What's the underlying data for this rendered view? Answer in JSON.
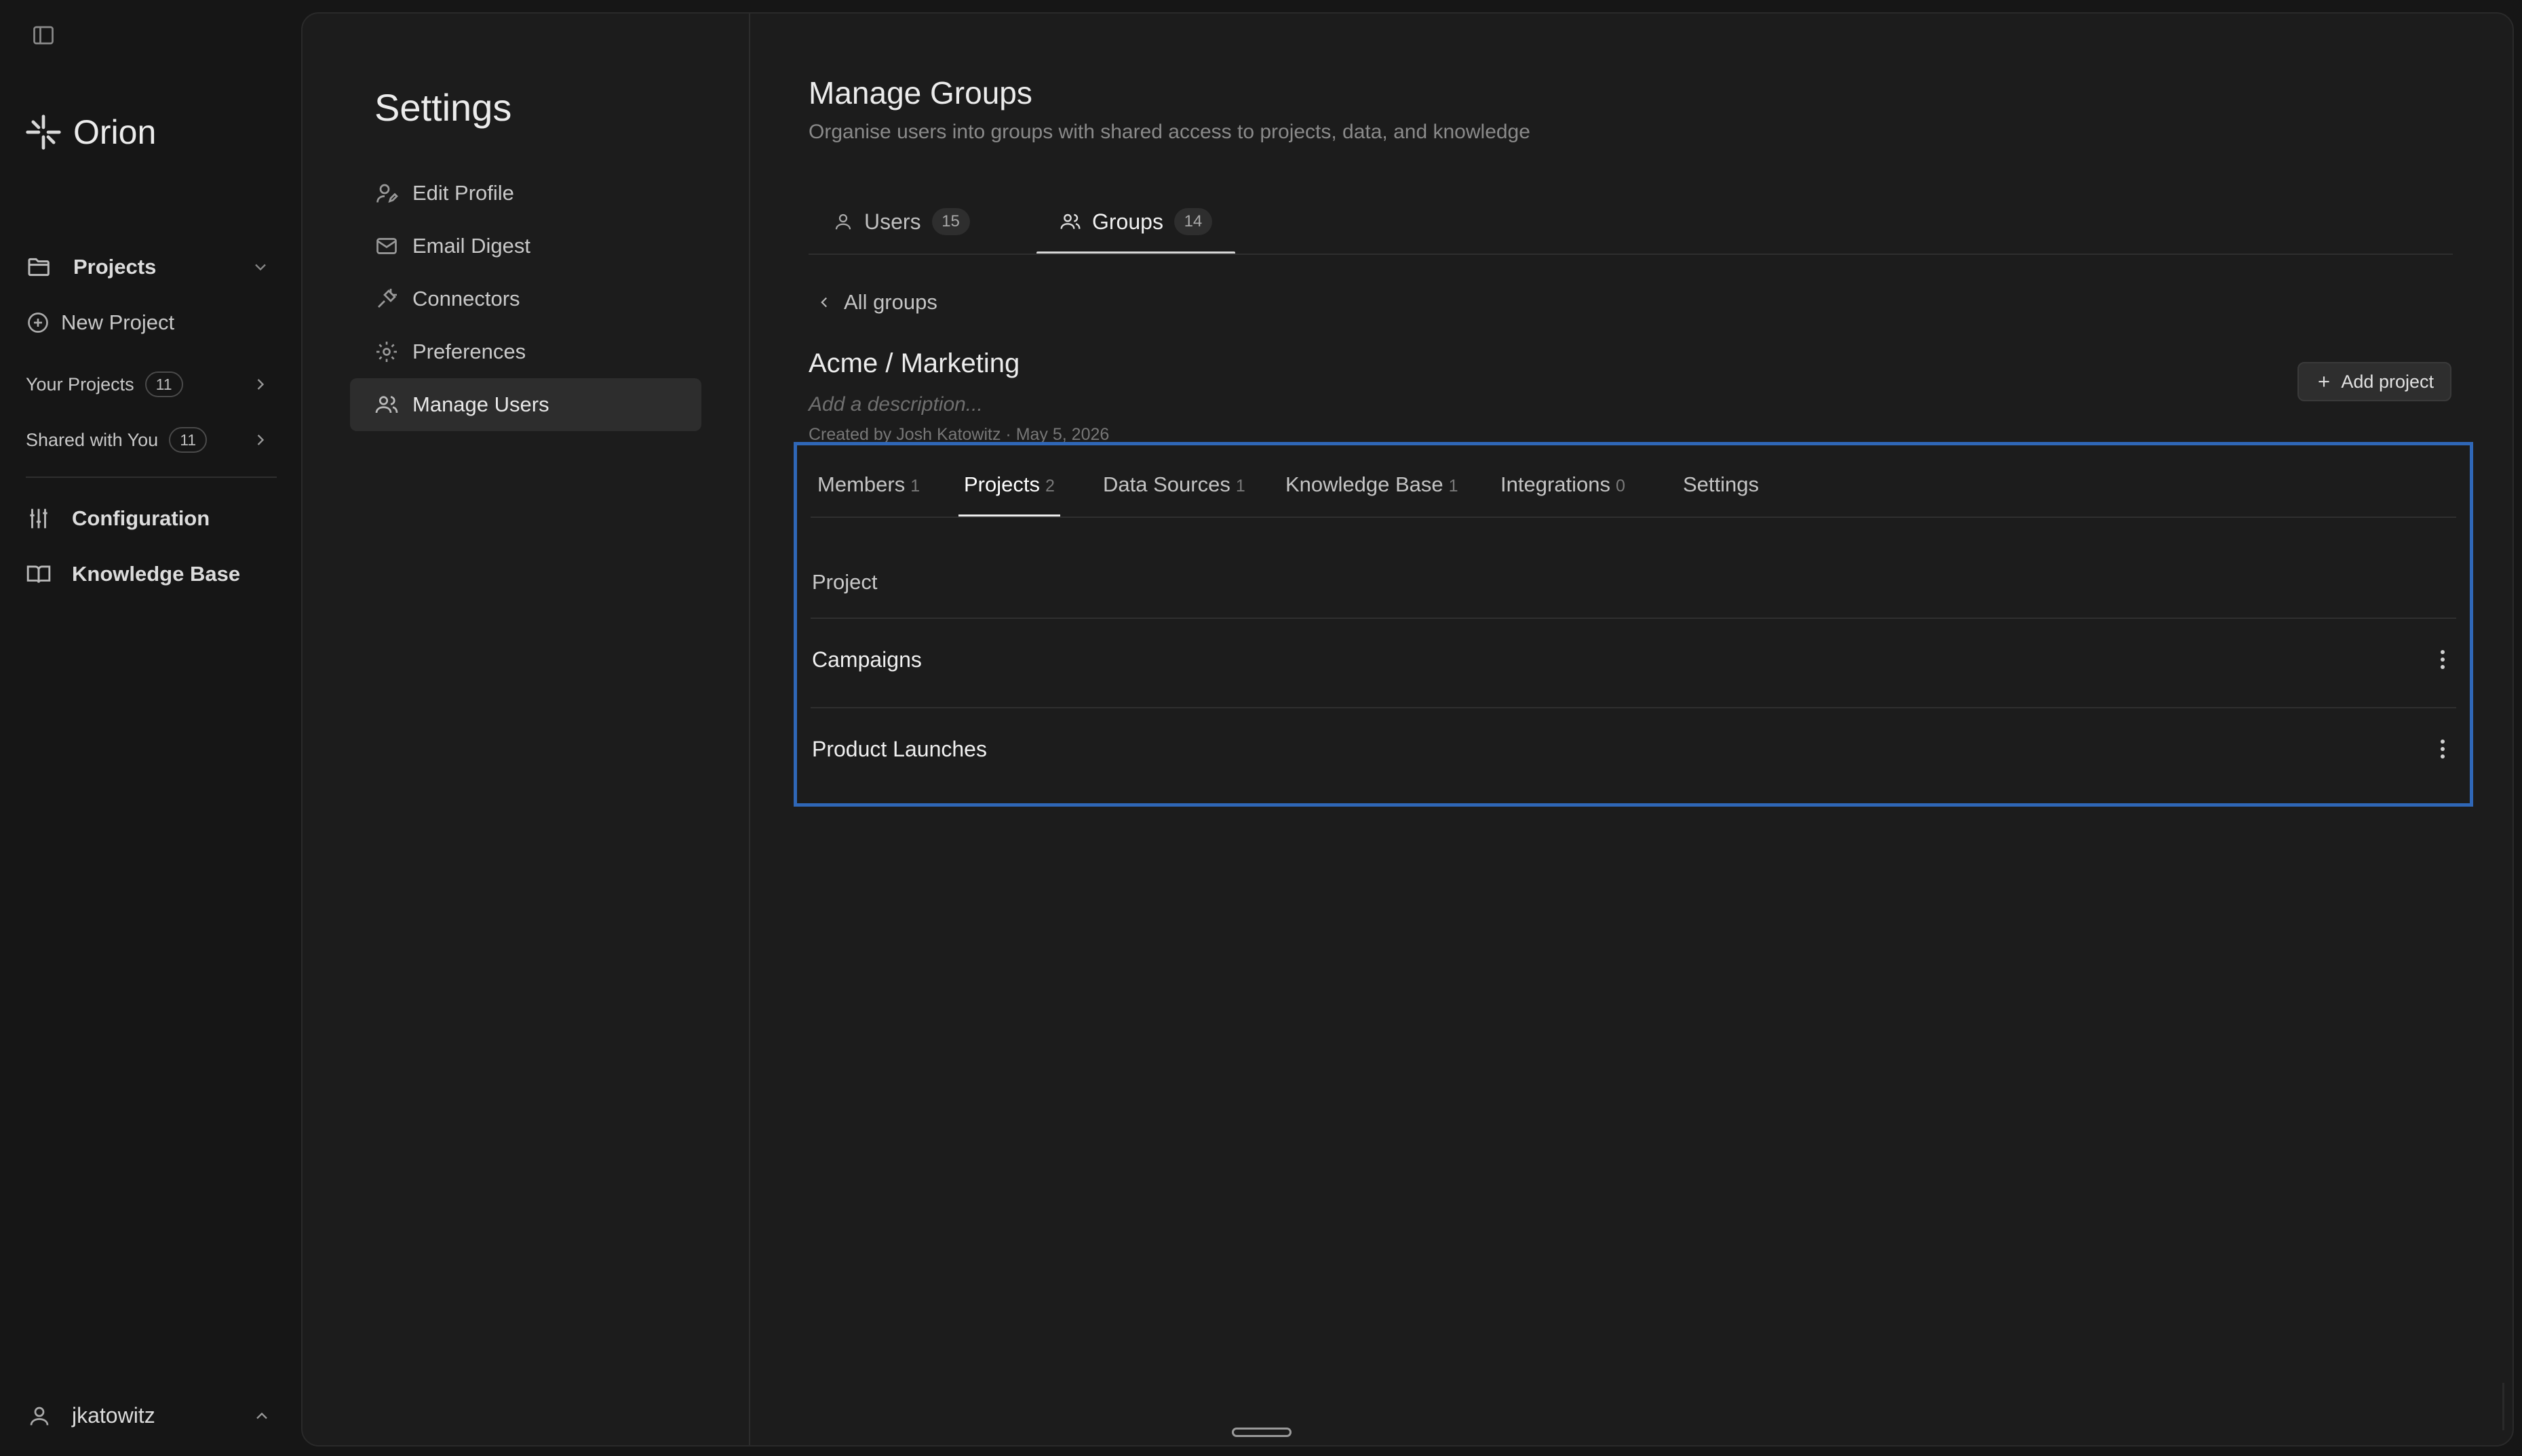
{
  "app": {
    "name": "Orion"
  },
  "sidebar": {
    "projects_label": "Projects",
    "new_project_label": "New Project",
    "your_projects": {
      "label": "Your Projects",
      "count": "11"
    },
    "shared_with_you": {
      "label": "Shared with You",
      "count": "11"
    },
    "configuration_label": "Configuration",
    "knowledge_base_label": "Knowledge Base",
    "user": {
      "name": "jkatowitz"
    }
  },
  "settings": {
    "title": "Settings",
    "nav": [
      {
        "label": "Edit Profile",
        "icon": "user-edit-icon"
      },
      {
        "label": "Email Digest",
        "icon": "mail-icon"
      },
      {
        "label": "Connectors",
        "icon": "plug-icon"
      },
      {
        "label": "Preferences",
        "icon": "gear-icon"
      },
      {
        "label": "Manage Users",
        "icon": "users-icon",
        "active": true
      }
    ]
  },
  "main": {
    "title": "Manage Groups",
    "subtitle": "Organise users into groups with shared access to projects, data, and knowledge",
    "tabs": [
      {
        "label": "Users",
        "count": "15"
      },
      {
        "label": "Groups",
        "count": "14",
        "active": true
      }
    ],
    "back_label": "All groups",
    "group": {
      "name": "Acme / Marketing",
      "description_placeholder": "Add a description...",
      "meta": "Created by Josh Katowitz · May 5, 2026",
      "add_project_label": "Add project",
      "subtabs": [
        {
          "label": "Members",
          "count": "1"
        },
        {
          "label": "Projects",
          "count": "2",
          "active": true
        },
        {
          "label": "Data Sources",
          "count": "1"
        },
        {
          "label": "Knowledge Base",
          "count": "1"
        },
        {
          "label": "Integrations",
          "count": "0"
        },
        {
          "label": "Settings",
          "count": ""
        }
      ],
      "column_header": "Project",
      "projects": [
        {
          "name": "Campaigns"
        },
        {
          "name": "Product Launches"
        }
      ]
    }
  },
  "colors": {
    "background": "#161616",
    "panel": "#1c1c1c",
    "selection_outline": "#2f67b7"
  }
}
